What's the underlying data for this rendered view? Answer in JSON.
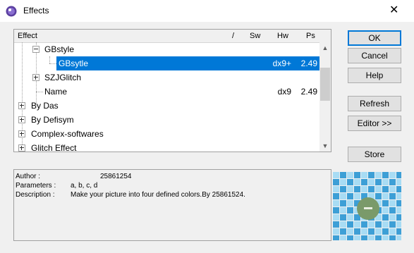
{
  "window": {
    "title": "Effects"
  },
  "tree": {
    "columns": [
      "Effect",
      "/",
      "Sw",
      "Hw",
      "Ps"
    ],
    "rows": [
      {
        "label": "GBstyle",
        "sw": "",
        "hw": "",
        "ps": ""
      },
      {
        "label": "GBsytle",
        "sw": "",
        "hw": "dx9+",
        "ps": "2.49"
      },
      {
        "label": "SZJGlitch",
        "sw": "",
        "hw": "",
        "ps": ""
      },
      {
        "label": "Name",
        "sw": "",
        "hw": "dx9",
        "ps": "2.49"
      },
      {
        "label": "By Das",
        "sw": "",
        "hw": "",
        "ps": ""
      },
      {
        "label": "By Defisym",
        "sw": "",
        "hw": "",
        "ps": ""
      },
      {
        "label": "Complex-softwares",
        "sw": "",
        "hw": "",
        "ps": ""
      },
      {
        "label": "Glitch Effect",
        "sw": "",
        "hw": "",
        "ps": ""
      }
    ]
  },
  "description": {
    "author_label": "Author :",
    "author_value": "25861254",
    "params_label": "Parameters :",
    "params_value": "a, b, c, d",
    "desc_label": "Description :",
    "desc_value": "Make your picture into four defined colors.By 25861524."
  },
  "buttons": {
    "ok": "OK",
    "cancel": "Cancel",
    "help": "Help",
    "refresh": "Refresh",
    "editor": "Editor >>",
    "store": "Store"
  },
  "colors": {
    "selection": "#0078d7",
    "preview_light": "#a8dcf4",
    "preview_dark": "#3d9fd6",
    "preview_ball": "#7a9a6a"
  }
}
